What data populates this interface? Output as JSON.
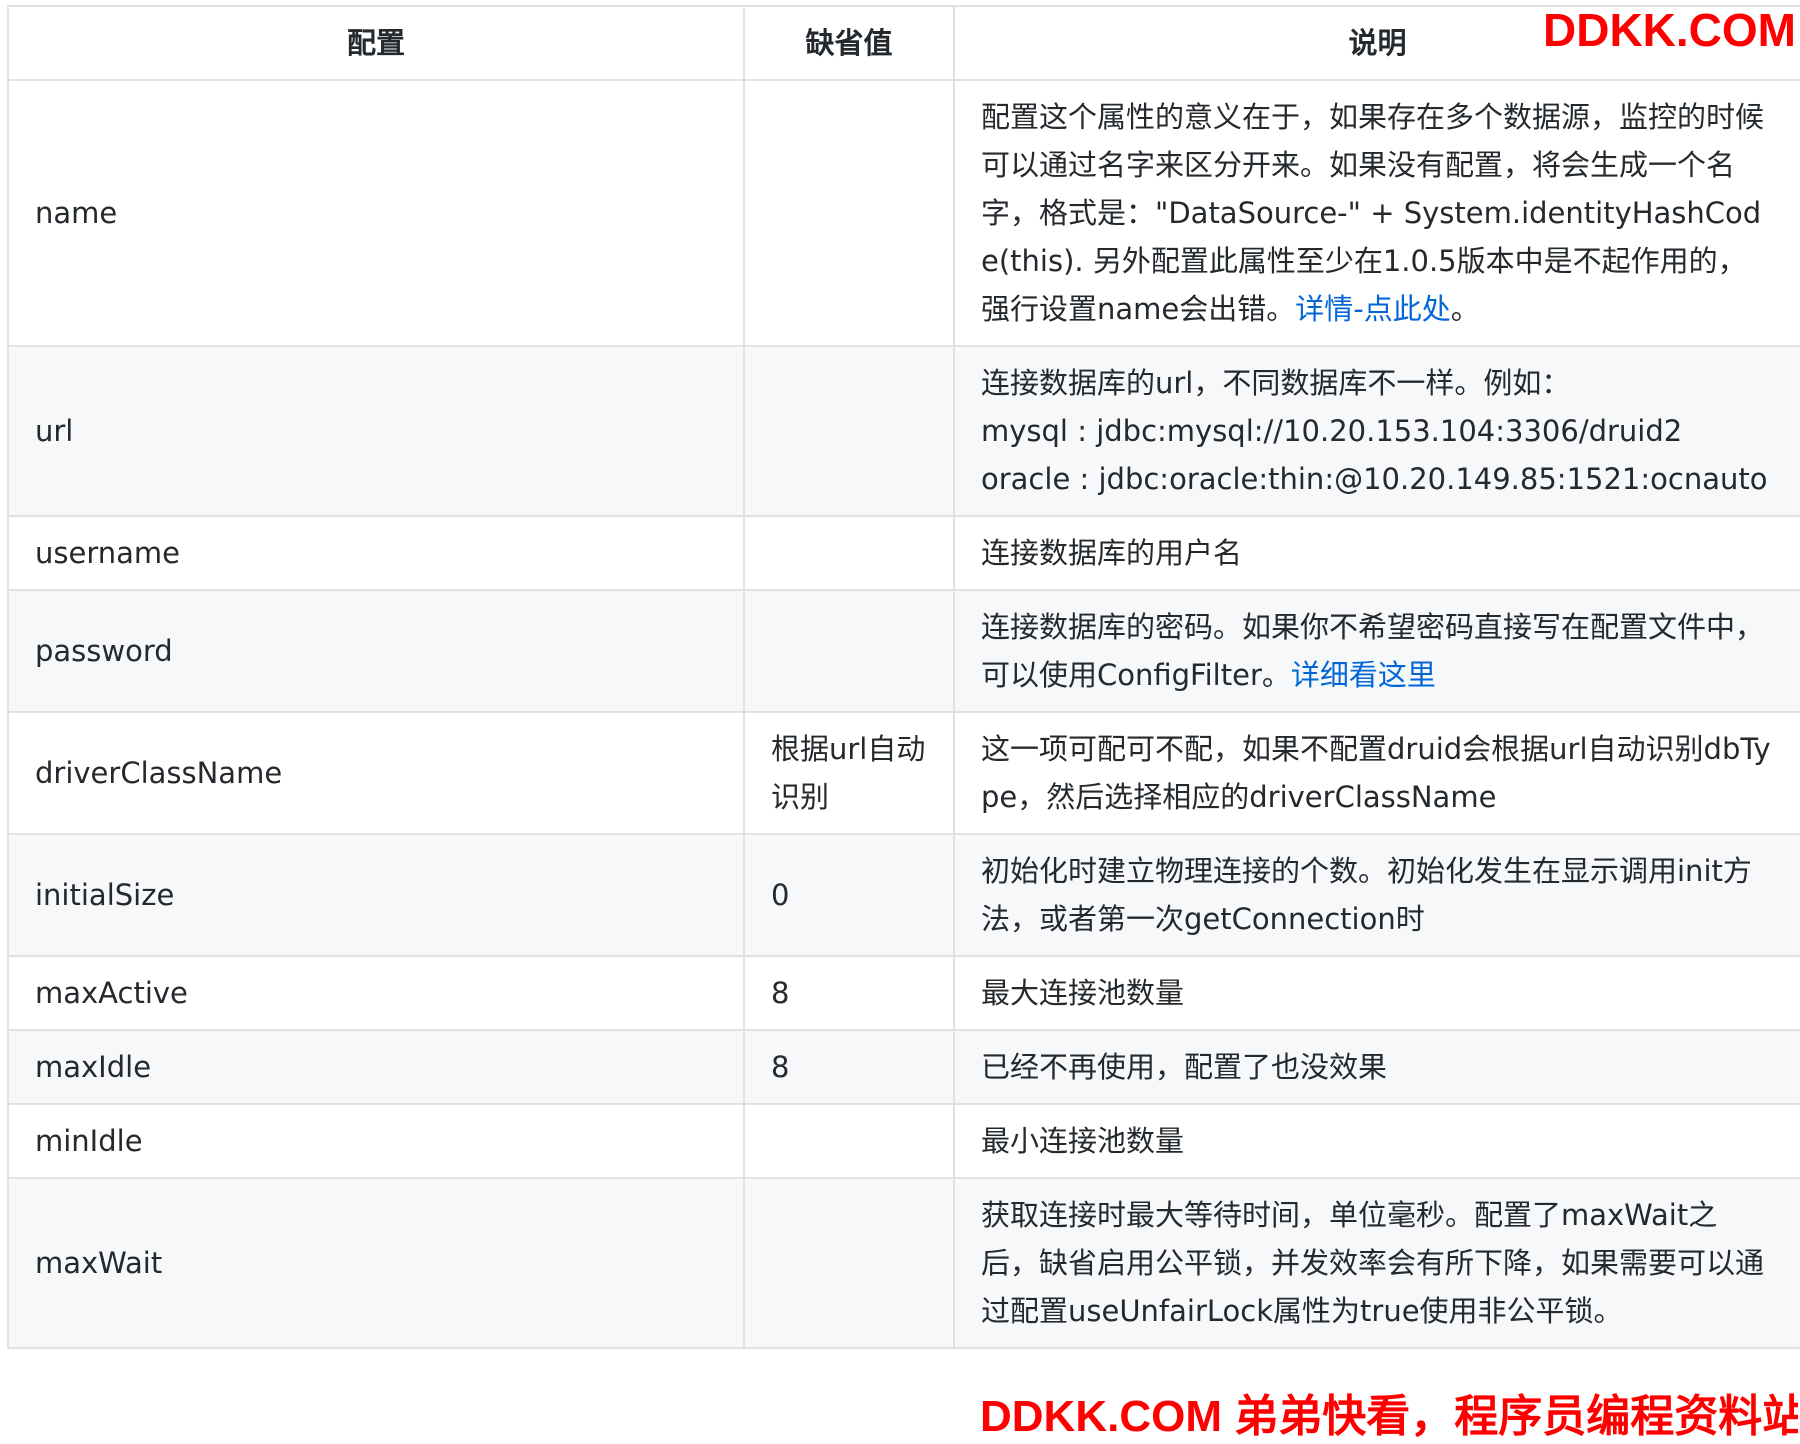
{
  "table": {
    "headers": [
      "配置",
      "缺省值",
      "说明"
    ],
    "rows": [
      {
        "name": "name",
        "default": "",
        "description": "配置这个属性的意义在于，如果存在多个数据源，监控的时候可以通过名字来区分开来。如果没有配置，将会生成一个名字，格式是：\"DataSource-\" + System.identityHashCode(this). 另外配置此属性至少在1.0.5版本中是不起作用的，强行设置name会出错。",
        "link": "详情-点此处",
        "after_link": "。"
      },
      {
        "name": "url",
        "default": "",
        "description_lines": [
          "连接数据库的url，不同数据库不一样。例如：",
          "mysql : jdbc:mysql://10.20.153.104:3306/druid2",
          "oracle : jdbc:oracle:thin:@10.20.149.85:1521:ocnauto"
        ]
      },
      {
        "name": "username",
        "default": "",
        "description": "连接数据库的用户名"
      },
      {
        "name": "password",
        "default": "",
        "description": "连接数据库的密码。如果你不希望密码直接写在配置文件中，可以使用ConfigFilter。",
        "link": "详细看这里"
      },
      {
        "name": "driverClassName",
        "default": "根据url自动识别",
        "description": "这一项可配可不配，如果不配置druid会根据url自动识别dbType，然后选择相应的driverClassName"
      },
      {
        "name": "initialSize",
        "default": "0",
        "description": "初始化时建立物理连接的个数。初始化发生在显示调用init方法，或者第一次getConnection时"
      },
      {
        "name": "maxActive",
        "default": "8",
        "description": "最大连接池数量"
      },
      {
        "name": "maxIdle",
        "default": "8",
        "description": "已经不再使用，配置了也没效果"
      },
      {
        "name": "minIdle",
        "default": "",
        "description": "最小连接池数量"
      },
      {
        "name": "maxWait",
        "default": "",
        "description": "获取连接时最大等待时间，单位毫秒。配置了maxWait之后，缺省启用公平锁，并发效率会有所下降，如果需要可以通过配置useUnfairLock属性为true使用非公平锁。"
      }
    ]
  },
  "watermark": {
    "top": "DDKK.COM",
    "bottom": "DDKK.COM 弟弟快看，程序员编程资料站"
  },
  "colors": {
    "link": "#0366d6",
    "watermark": "#ff0000",
    "border": "#dfe2e5",
    "stripe": "#f6f8fa"
  }
}
